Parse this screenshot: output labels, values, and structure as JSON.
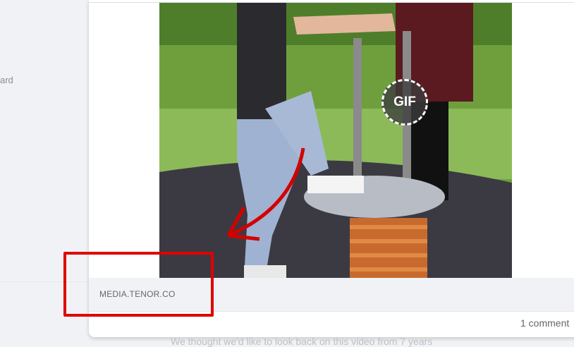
{
  "sidebar": {
    "partial_label": "ard"
  },
  "post": {
    "media": {
      "badge_label": "GIF"
    },
    "link_preview": {
      "domain": "MEDIA.TENOR.CO"
    },
    "footer": {
      "comment_count": "1 comment"
    }
  },
  "below_text": "We thought we'd like to look back on this video from 7 years",
  "colors": {
    "annotation_red": "#e00000",
    "link_bar_bg": "#f0f2f5",
    "page_bg": "#f0f2f5"
  }
}
